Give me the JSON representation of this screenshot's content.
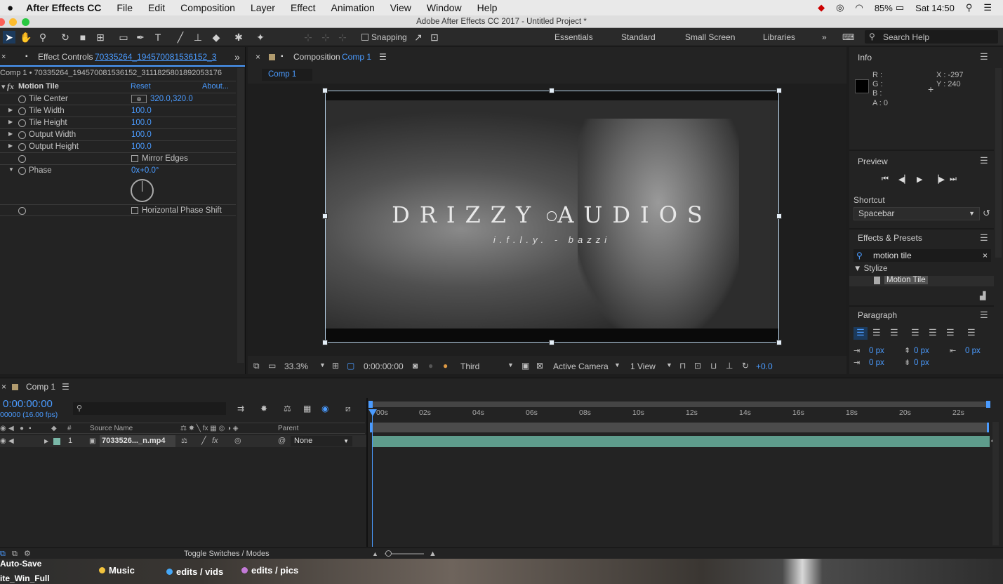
{
  "menubar": {
    "app": "After Effects CC",
    "items": [
      "File",
      "Edit",
      "Composition",
      "Layer",
      "Effect",
      "Animation",
      "View",
      "Window",
      "Help"
    ],
    "battery": "85%",
    "clock": "Sat 14:50"
  },
  "window": {
    "title": "Adobe After Effects CC 2017 - Untitled Project *"
  },
  "toolbar": {
    "snapping": "Snapping",
    "workspaces": [
      "Essentials",
      "Standard",
      "Small Screen",
      "Libraries"
    ],
    "search_placeholder": "Search Help"
  },
  "effect_controls": {
    "tab_prefix": "Effect Controls",
    "tab_file": "70335264_194570081536152_3",
    "breadcrumb": "Comp 1 • 70335264_194570081536152_3111825801892053176",
    "effect_name": "Motion Tile",
    "reset": "Reset",
    "about": "About...",
    "props": [
      {
        "label": "Tile Center",
        "value": "320.0,320.0"
      },
      {
        "label": "Tile Width",
        "value": "100.0"
      },
      {
        "label": "Tile Height",
        "value": "100.0"
      },
      {
        "label": "Output Width",
        "value": "100.0"
      },
      {
        "label": "Output Height",
        "value": "100.0"
      },
      {
        "label": "",
        "value": "Mirror Edges"
      },
      {
        "label": "Phase",
        "value": "0x+0.0°"
      },
      {
        "label": "",
        "value": "Horizontal Phase Shift"
      }
    ]
  },
  "composition": {
    "tab_prefix": "Composition",
    "tab_name": "Comp 1",
    "subtab": "Comp 1",
    "overlay_title": "DRIZZY AUDIOS",
    "overlay_sub": "i.f.l.y. - bazzi",
    "footer": {
      "zoom": "33.3%",
      "timecode": "0:00:00:00",
      "resolution": "Third",
      "camera": "Active Camera",
      "views": "1 View",
      "exposure": "+0.0"
    }
  },
  "info": {
    "title": "Info",
    "r": "R :",
    "g": "G :",
    "b": "B :",
    "a": "A : 0",
    "x": "X : -297",
    "y": "Y : 240"
  },
  "preview": {
    "title": "Preview",
    "shortcut_label": "Shortcut",
    "shortcut": "Spacebar"
  },
  "effects_presets": {
    "title": "Effects & Presets",
    "search": "motion tile",
    "category": "▼ Stylize",
    "item": "Motion Tile"
  },
  "paragraph": {
    "title": "Paragraph",
    "values": [
      "0 px",
      "0 px",
      "0 px",
      "0 px",
      "0 px"
    ]
  },
  "timeline": {
    "tab": "Comp 1",
    "timecode": "0:00:00:00",
    "fps": "00000 (16.00 fps)",
    "col_source": "Source Name",
    "col_parent": "Parent",
    "layer_num": "1",
    "layer_name": "7033526..._n.mp4",
    "layer_parent": "None",
    "ticks": [
      "00s",
      "02s",
      "04s",
      "06s",
      "08s",
      "10s",
      "12s",
      "14s",
      "16s",
      "18s",
      "20s",
      "22s"
    ],
    "toggle": "Toggle Switches / Modes"
  },
  "dock": {
    "items": [
      "Auto-Save",
      "ite_Win_Full",
      "Music",
      "edits / vids",
      "edits / pics"
    ]
  },
  "colors": {
    "accent": "#4a9bff",
    "layer_bar": "#5e9c8c",
    "panel": "#232323"
  }
}
